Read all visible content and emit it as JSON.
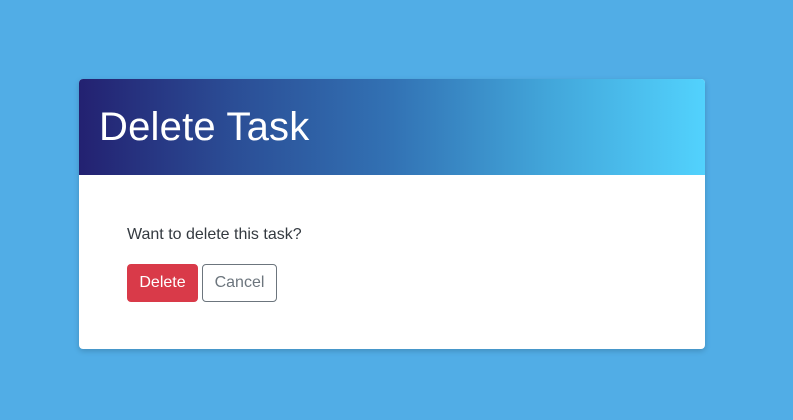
{
  "dialog": {
    "title": "Delete Task",
    "message": "Want to delete this task?",
    "delete_label": "Delete",
    "cancel_label": "Cancel"
  },
  "colors": {
    "page_background": "#51ade6",
    "header_gradient_start": "#232171",
    "header_gradient_end": "#52d2fd",
    "delete_button": "#d93a49",
    "cancel_border": "#6c757d"
  }
}
